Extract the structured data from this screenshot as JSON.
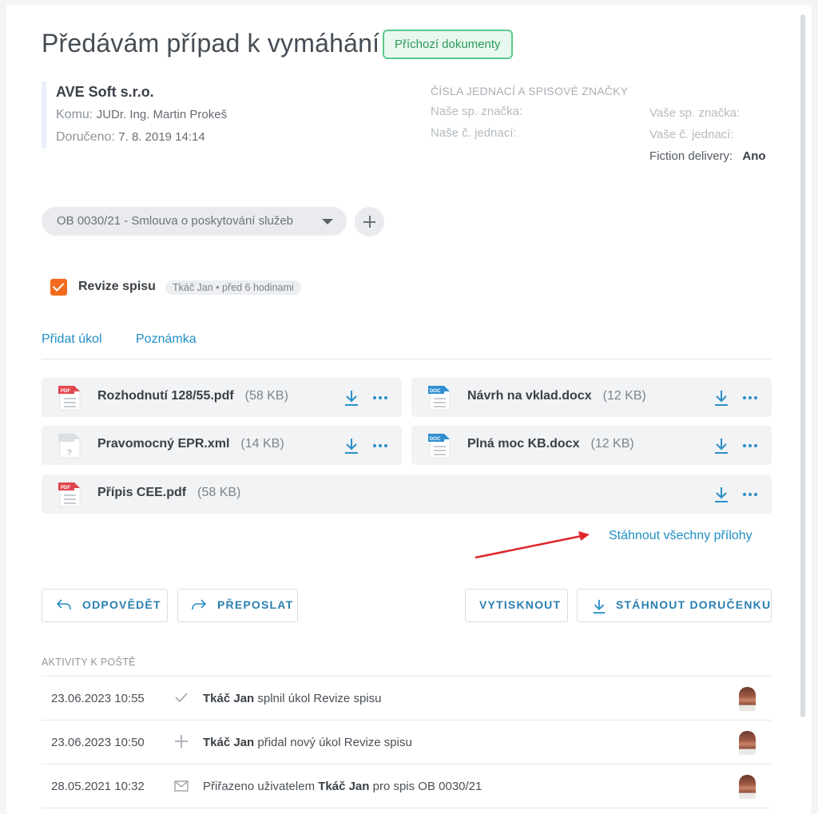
{
  "header": {
    "title": "Předávám případ k vymáhání",
    "badge": "Příchozí dokumenty"
  },
  "sender": {
    "name": "AVE Soft s.r.o.",
    "to_label": "Komu:",
    "to_value": "JUDr. Ing. Martin Prokeš",
    "delivered_label": "Doručeno:",
    "delivered_value": "7. 8. 2019 14:14"
  },
  "references": {
    "title": "Čísla jednací a spisové značky",
    "our_mark": "Naše sp. značka:",
    "our_ref": "Naše č. jednací:",
    "your_mark": "Vaše sp. značka:",
    "your_ref": "Vaše č. jednací:",
    "fiction_label": "Fiction delivery:",
    "fiction_value": "Ano"
  },
  "case_select": {
    "value": "OB 0030/21 - Smlouva o poskytování služeb"
  },
  "task": {
    "label": "Revize spisu",
    "meta": "Tkáč Jan • před 6 hodinami",
    "checked": true
  },
  "actions": {
    "add_task": "Přidat úkol",
    "note": "Poznámka"
  },
  "attachments": [
    {
      "name": "Rozhodnutí 128/55.pdf",
      "size": "(58 KB)",
      "type": "pdf"
    },
    {
      "name": "Návrh na vklad.docx",
      "size": "(12 KB)",
      "type": "doc"
    },
    {
      "name": "Pravomocný EPR.xml",
      "size": "(14 KB)",
      "type": "unknown"
    },
    {
      "name": "Plná moc KB.docx",
      "size": "(12 KB)",
      "type": "doc"
    },
    {
      "name": "Přípis CEE.pdf",
      "size": "(58 KB)",
      "type": "pdf"
    }
  ],
  "file_icon_labels": {
    "pdf": "PDF",
    "doc": "DOC",
    "unknown": "?"
  },
  "download_all": "Stáhnout všechny přílohy",
  "buttons": {
    "reply": "Odpovědět",
    "forward": "Přeposlat",
    "print": "Vytisknout",
    "download_receipt": "Stáhnout doručenku"
  },
  "activities": {
    "title": "AKTIVITY K POŠTĚ",
    "items": [
      {
        "date": "23.06.2023 10:55",
        "icon": "check-icon",
        "user": "Tkáč Jan",
        "text": " splnil úkol Revize spisu"
      },
      {
        "date": "23.06.2023 10:50",
        "icon": "plus-icon",
        "user": "Tkáč Jan",
        "text": " přidal nový úkol Revize spisu"
      },
      {
        "date": "28.05.2021 10:32",
        "icon": "mail-icon",
        "pre": "Přiřazeno uživatelem ",
        "user": "Tkáč Jan",
        "text": " pro spis OB 0030/21"
      }
    ]
  },
  "colors": {
    "accent": "#1f8fc4",
    "badge_green": "#2a9a58",
    "checkbox_orange": "#f36b1f",
    "pdf_red": "#e1474d",
    "doc_blue": "#2f8fd0",
    "annotation_arrow": "#e0262a"
  }
}
